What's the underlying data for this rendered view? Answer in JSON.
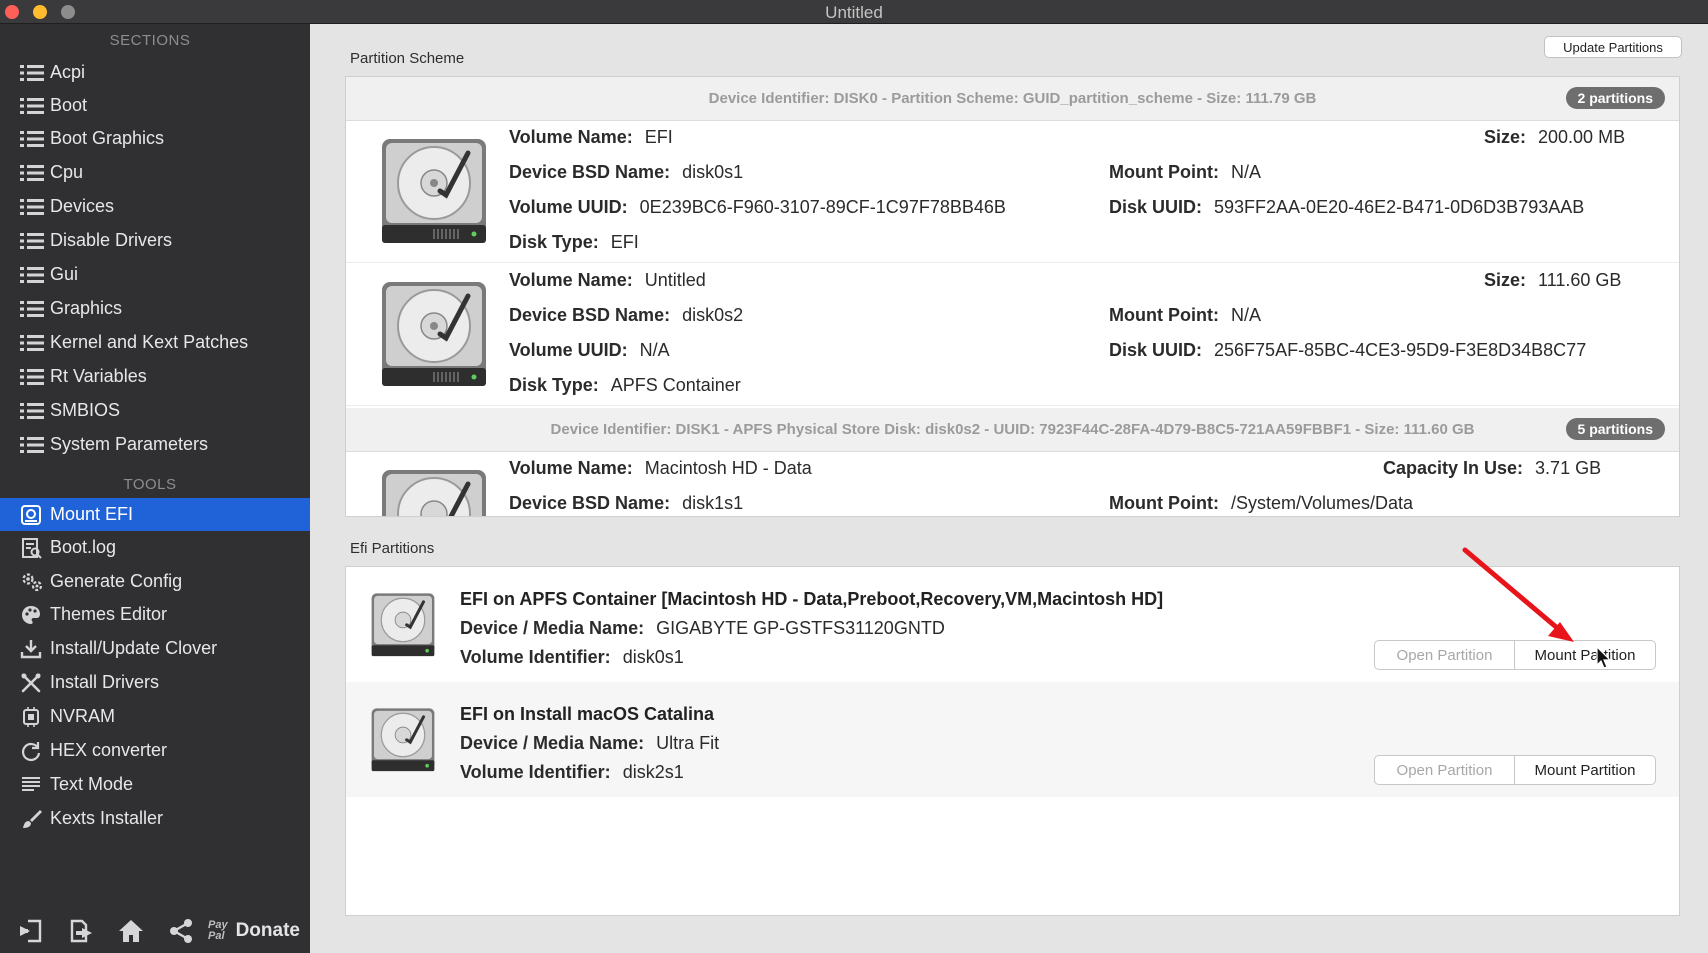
{
  "window": {
    "title": "Untitled"
  },
  "sidebar": {
    "sections_label": "SECTIONS",
    "tools_label": "TOOLS",
    "sections": [
      {
        "label": "Acpi",
        "icon": "list-icon"
      },
      {
        "label": "Boot",
        "icon": "list-icon"
      },
      {
        "label": "Boot Graphics",
        "icon": "list-icon"
      },
      {
        "label": "Cpu",
        "icon": "list-icon"
      },
      {
        "label": "Devices",
        "icon": "list-icon"
      },
      {
        "label": "Disable Drivers",
        "icon": "list-icon"
      },
      {
        "label": "Gui",
        "icon": "list-icon"
      },
      {
        "label": "Graphics",
        "icon": "list-icon"
      },
      {
        "label": "Kernel and Kext Patches",
        "icon": "list-icon"
      },
      {
        "label": "Rt Variables",
        "icon": "list-icon"
      },
      {
        "label": "SMBIOS",
        "icon": "list-icon"
      },
      {
        "label": "System Parameters",
        "icon": "list-icon"
      }
    ],
    "tools": [
      {
        "label": "Mount EFI",
        "icon": "disk-icon",
        "active": true
      },
      {
        "label": "Boot.log",
        "icon": "log-icon"
      },
      {
        "label": "Generate Config",
        "icon": "gears-icon"
      },
      {
        "label": "Themes Editor",
        "icon": "palette-icon"
      },
      {
        "label": "Install/Update Clover",
        "icon": "download-icon"
      },
      {
        "label": "Install Drivers",
        "icon": "tools-icon"
      },
      {
        "label": "NVRAM",
        "icon": "chip-icon"
      },
      {
        "label": "HEX converter",
        "icon": "refresh-icon"
      },
      {
        "label": "Text Mode",
        "icon": "text-icon"
      },
      {
        "label": "Kexts Installer",
        "icon": "brush-icon"
      }
    ],
    "bottom": {
      "paypal_line1": "Pay",
      "paypal_line2": "Pal",
      "donate_label": "Donate"
    }
  },
  "partition_scheme": {
    "title": "Partition Scheme",
    "update_button": "Update Partitions",
    "devices": [
      {
        "header": "Device Identifier: DISK0 - Partition Scheme: GUID_partition_scheme - Size: 111.79 GB",
        "badge": "2 partitions",
        "partitions": [
          {
            "volume_name_label": "Volume Name:",
            "volume_name": "EFI",
            "size_label": "Size:",
            "size": "200.00 MB",
            "bsd_label": "Device BSD Name:",
            "bsd": "disk0s1",
            "mount_label": "Mount Point:",
            "mount": "N/A",
            "vuuid_label": "Volume UUID:",
            "vuuid": "0E239BC6-F960-3107-89CF-1C97F78BB46B",
            "duuid_label": "Disk UUID:",
            "duuid": "593FF2AA-0E20-46E2-B471-0D6D3B793AAB",
            "type_label": "Disk Type:",
            "type": "EFI"
          },
          {
            "volume_name_label": "Volume Name:",
            "volume_name": "Untitled",
            "size_label": "Size:",
            "size": "111.60 GB",
            "bsd_label": "Device BSD Name:",
            "bsd": "disk0s2",
            "mount_label": "Mount Point:",
            "mount": "N/A",
            "vuuid_label": "Volume UUID:",
            "vuuid": "N/A",
            "duuid_label": "Disk UUID:",
            "duuid": "256F75AF-85BC-4CE3-95D9-F3E8D34B8C77",
            "type_label": "Disk Type:",
            "type": "APFS Container"
          }
        ]
      },
      {
        "header": "Device Identifier: DISK1 - APFS Physical Store Disk: disk0s2 - UUID: 7923F44C-28FA-4D79-B8C5-721AA59FBBF1 - Size: 111.60 GB",
        "badge": "5 partitions",
        "partitions": [
          {
            "volume_name_label": "Volume Name:",
            "volume_name": "Macintosh HD - Data",
            "size_label": "Capacity In Use:",
            "size": "3.71 GB",
            "bsd_label": "Device BSD Name:",
            "bsd": "disk1s1",
            "mount_label": "Mount Point:",
            "mount": "/System/Volumes/Data"
          }
        ]
      }
    ]
  },
  "efi_partitions": {
    "title": "Efi Partitions",
    "items": [
      {
        "title": "EFI on APFS Container [Macintosh HD - Data,Preboot,Recovery,VM,Macintosh HD]",
        "media_label": "Device / Media Name:",
        "media": "GIGABYTE GP-GSTFS31120GNTD",
        "vol_label": "Volume Identifier:",
        "vol": "disk0s1",
        "open_label": "Open Partition",
        "mount_label": "Mount Partition"
      },
      {
        "title": "EFI on Install macOS Catalina",
        "media_label": "Device / Media Name:",
        "media": "Ultra Fit",
        "vol_label": "Volume Identifier:",
        "vol": "disk2s1",
        "open_label": "Open Partition",
        "mount_label": "Mount Partition"
      }
    ]
  },
  "colors": {
    "accent": "#2063d8",
    "annotation_arrow": "#e8141b"
  }
}
